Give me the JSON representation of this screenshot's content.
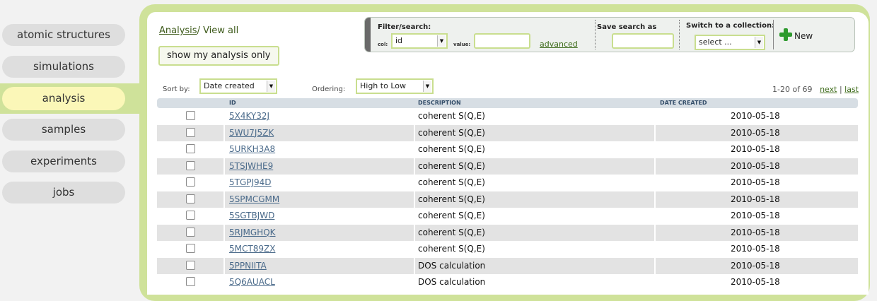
{
  "nav": {
    "items": [
      {
        "label": "atomic structures"
      },
      {
        "label": "simulations"
      },
      {
        "label": "analysis"
      },
      {
        "label": "samples"
      },
      {
        "label": "experiments"
      },
      {
        "label": "jobs"
      }
    ],
    "active": "analysis"
  },
  "breadcrumb": {
    "link": "Analysis",
    "current": "/ View all"
  },
  "show_mine_button": "show my analysis only",
  "filter": {
    "title": "Filter/search:",
    "col_label": "col:",
    "col_value": "id",
    "value_label": "value:",
    "value": "",
    "advanced_link": "advanced",
    "save_title": "Save search as",
    "save_value": "",
    "collection_title": "Switch to a collection:",
    "collection_value": "select ...",
    "new_label": "New"
  },
  "sort": {
    "sort_by_label": "Sort by:",
    "sort_by_value": "Date created",
    "ordering_label": "Ordering:",
    "ordering_value": "High to Low"
  },
  "pager": {
    "range": "1-20 of 69",
    "next": "next",
    "sep": "|",
    "last": "last"
  },
  "table": {
    "headers": {
      "id": "ID",
      "description": "DESCRIPTION",
      "date": "DATE CREATED"
    },
    "rows": [
      {
        "id": "5X4KY32J",
        "description": "coherent S(Q,E)",
        "date": "2010-05-18"
      },
      {
        "id": "5WU7J5ZK",
        "description": "coherent S(Q,E)",
        "date": "2010-05-18"
      },
      {
        "id": "5URKH3A8",
        "description": "coherent S(Q,E)",
        "date": "2010-05-18"
      },
      {
        "id": "5TSJWHE9",
        "description": "coherent S(Q,E)",
        "date": "2010-05-18"
      },
      {
        "id": "5TGPJ94D",
        "description": "coherent S(Q,E)",
        "date": "2010-05-18"
      },
      {
        "id": "5SPMCGMM",
        "description": "coherent S(Q,E)",
        "date": "2010-05-18"
      },
      {
        "id": "5SGTBJWD",
        "description": "coherent S(Q,E)",
        "date": "2010-05-18"
      },
      {
        "id": "5RJMGHQK",
        "description": "coherent S(Q,E)",
        "date": "2010-05-18"
      },
      {
        "id": "5MCT89ZX",
        "description": "coherent S(Q,E)",
        "date": "2010-05-18"
      },
      {
        "id": "5PPNIITA",
        "description": "DOS calculation",
        "date": "2010-05-18"
      },
      {
        "id": "5Q6AUACL",
        "description": "DOS calculation",
        "date": "2010-05-18"
      }
    ]
  },
  "colors": {
    "accent": "#cfe29a",
    "active_nav": "#fbf7b8",
    "link": "#3d6b1a"
  }
}
